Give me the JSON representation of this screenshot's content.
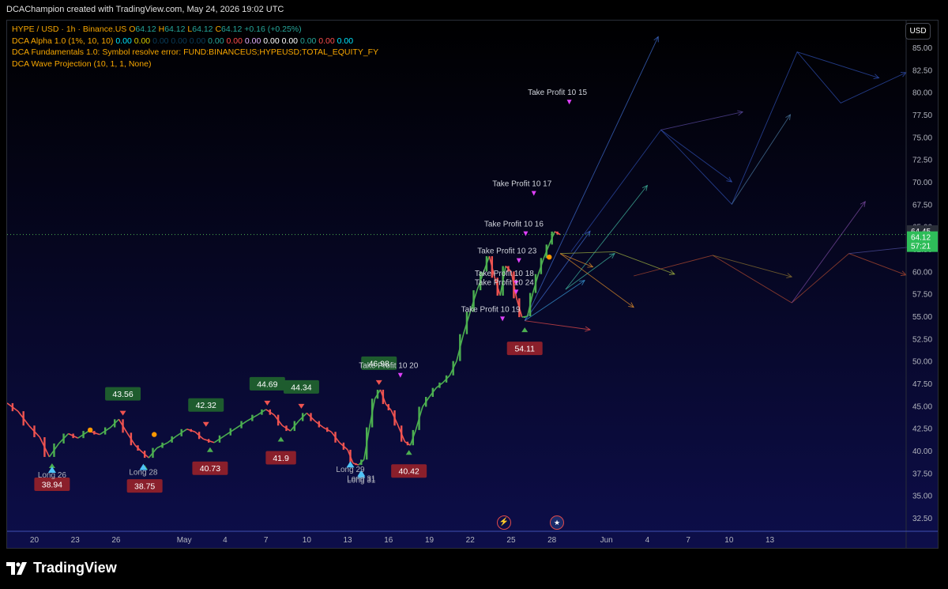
{
  "header": {
    "watermark": "DCAChampion created with TradingView.com, May 24, 2026 19:02 UTC",
    "currency_button": "USD"
  },
  "legend": {
    "symbol": "HYPE / USD · 1h · Binance.US",
    "o_label": "O",
    "o_value": "64.12",
    "h_label": "H",
    "h_value": "64.12",
    "l_label": "L",
    "l_value": "64.12",
    "c_label": "C",
    "c_value": "64.12",
    "change": "+0.16 (+0.25%)",
    "dca_alpha": "DCA Alpha 1.0 (1%, 10, 10)",
    "dca_alpha_values": [
      "0.00",
      "0.00",
      "0.00",
      "0.00",
      "0.00",
      "0.00",
      "0.00",
      "0.00",
      "0.00",
      "0.00",
      "0.00",
      "0.00",
      "0.00",
      "0.00",
      "0.00"
    ],
    "dca_fundamentals": "DCA Fundamentals 1.0: Symbol resolve error: FUND:BINANCEUS;HYPEUSD;TOTAL_EQUITY_FY",
    "dca_wave": "DCA Wave Projection (10, 1, 1, None)"
  },
  "footer": {
    "brand": "TradingView"
  },
  "colors": {
    "background": "#000000",
    "chart_bg_top": "#000000",
    "chart_bg_bottom": "#0d0e4a",
    "up": "#4caf50",
    "down": "#ef5350",
    "label_green": "#1e5c2e",
    "label_red": "#8a1f2b",
    "price_line": "#4caf50",
    "price_badge": "#2ebd59"
  },
  "chart_data": {
    "type": "candlestick",
    "y_ticks": [
      "85.00",
      "82.50",
      "80.00",
      "77.50",
      "75.00",
      "72.50",
      "70.00",
      "67.50",
      "65.00",
      "62.50",
      "60.00",
      "57.50",
      "55.00",
      "52.50",
      "50.00",
      "47.50",
      "45.00",
      "42.50",
      "40.00",
      "37.50",
      "35.00",
      "32.50"
    ],
    "ylim": [
      31,
      88
    ],
    "x_ticks": [
      "20",
      "23",
      "26",
      "May",
      "4",
      "7",
      "10",
      "13",
      "16",
      "19",
      "22",
      "25",
      "28",
      "Jun",
      "4",
      "7",
      "10",
      "13"
    ],
    "x_tick_days": [
      -11,
      -8,
      -5,
      0,
      3,
      6,
      9,
      12,
      15,
      18,
      21,
      24,
      27,
      31,
      34,
      37,
      40,
      43
    ],
    "x_range_days": [
      -13,
      53
    ],
    "current_price": {
      "value": 64.12,
      "badge_value": "64.12",
      "countdown": "57:21"
    },
    "high_badge": {
      "value": 64.45,
      "label": "64.45"
    },
    "price_path": [
      [
        -13,
        45.3
      ],
      [
        -12.2,
        44.4
      ],
      [
        -11.4,
        42.8
      ],
      [
        -10.6,
        41.5
      ],
      [
        -9.9,
        39.3
      ],
      [
        -9.2,
        40.8
      ],
      [
        -8.5,
        41.9
      ],
      [
        -7.8,
        41.4
      ],
      [
        -7.0,
        42.2
      ],
      [
        -6.2,
        41.8
      ],
      [
        -5.4,
        42.6
      ],
      [
        -4.8,
        43.5
      ],
      [
        -4.2,
        42.0
      ],
      [
        -3.6,
        40.6
      ],
      [
        -3.2,
        40.0
      ],
      [
        -2.6,
        39.2
      ],
      [
        -2.0,
        40.3
      ],
      [
        -1.2,
        40.9
      ],
      [
        -0.6,
        41.6
      ],
      [
        0.2,
        42.4
      ],
      [
        0.8,
        42.1
      ],
      [
        1.4,
        41.3
      ],
      [
        2.2,
        40.9
      ],
      [
        3.0,
        41.7
      ],
      [
        3.8,
        42.5
      ],
      [
        4.6,
        43.3
      ],
      [
        5.4,
        44.0
      ],
      [
        6.0,
        44.6
      ],
      [
        6.6,
        44.0
      ],
      [
        7.2,
        42.8
      ],
      [
        7.8,
        42.2
      ],
      [
        8.4,
        43.3
      ],
      [
        9.0,
        44.2
      ],
      [
        9.6,
        43.3
      ],
      [
        10.2,
        42.6
      ],
      [
        10.8,
        42.1
      ],
      [
        11.4,
        40.9
      ],
      [
        12.0,
        40.1
      ],
      [
        12.4,
        38.6
      ],
      [
        12.8,
        38.4
      ],
      [
        13.2,
        39.0
      ],
      [
        13.6,
        42.6
      ],
      [
        14.0,
        45.8
      ],
      [
        14.4,
        46.8
      ],
      [
        14.8,
        45.2
      ],
      [
        15.2,
        44.5
      ],
      [
        15.7,
        42.8
      ],
      [
        16.2,
        41.0
      ],
      [
        16.6,
        40.6
      ],
      [
        17.0,
        42.3
      ],
      [
        17.5,
        44.9
      ],
      [
        18.0,
        46.0
      ],
      [
        18.5,
        47.0
      ],
      [
        19.0,
        47.6
      ],
      [
        19.5,
        48.4
      ],
      [
        20.0,
        50.0
      ],
      [
        20.5,
        53.0
      ],
      [
        21.0,
        55.5
      ],
      [
        21.5,
        57.9
      ],
      [
        22.0,
        60.0
      ],
      [
        22.4,
        61.7
      ],
      [
        22.8,
        59.3
      ],
      [
        23.2,
        57.3
      ],
      [
        23.6,
        60.6
      ],
      [
        24.0,
        60.0
      ],
      [
        24.4,
        57.0
      ],
      [
        24.8,
        54.9
      ],
      [
        25.2,
        55.0
      ],
      [
        25.6,
        57.6
      ],
      [
        26.0,
        59.7
      ],
      [
        26.4,
        61.5
      ],
      [
        26.8,
        63.0
      ],
      [
        27.2,
        64.45
      ],
      [
        27.6,
        64.12
      ]
    ],
    "value_labels": [
      {
        "text": "43.56",
        "day": -4.5,
        "price": 43.56,
        "kind": "high"
      },
      {
        "text": "42.32",
        "day": 1.6,
        "price": 42.32,
        "kind": "high"
      },
      {
        "text": "44.69",
        "day": 6.1,
        "price": 44.69,
        "kind": "high"
      },
      {
        "text": "44.34",
        "day": 8.6,
        "price": 44.34,
        "kind": "high"
      },
      {
        "text": "46.98",
        "day": 14.3,
        "price": 46.98,
        "kind": "high"
      },
      {
        "text": "38.94",
        "day": -9.7,
        "price": 38.94,
        "kind": "low"
      },
      {
        "text": "38.75",
        "day": -2.9,
        "price": 38.75,
        "kind": "low"
      },
      {
        "text": "40.73",
        "day": 1.9,
        "price": 40.73,
        "kind": "low"
      },
      {
        "text": "41.9",
        "day": 7.1,
        "price": 41.9,
        "kind": "low"
      },
      {
        "text": "40.42",
        "day": 16.5,
        "price": 40.42,
        "kind": "low"
      },
      {
        "text": "54.11",
        "day": 25.0,
        "price": 54.11,
        "kind": "low"
      }
    ],
    "annotations": [
      {
        "text": "Take Profit 10 15",
        "day": 27.4
      },
      {
        "text": "Take Profit 10 17",
        "day": 24.8
      },
      {
        "text": "Take Profit 10 16",
        "day": 24.2
      },
      {
        "text": "Take Profit 10 23",
        "day": 23.7
      },
      {
        "text": "Take Profit 10 18",
        "day": 23.5
      },
      {
        "text": "Take Profit 10 24",
        "day": 23.5
      },
      {
        "text": "Take Profit 10 19",
        "day": 22.5
      },
      {
        "text": "Take Profit 10 20",
        "day": 15.0
      },
      {
        "text": "Long 26",
        "day": -9.7
      },
      {
        "text": "Long 28",
        "day": -3.0
      },
      {
        "text": "Long 29",
        "day": 12.2
      },
      {
        "text": "Long 31",
        "day": 13.0
      },
      {
        "text": "Long 31",
        "day": 13.0
      }
    ],
    "wave_projection": [
      {
        "color": "#3f6ccf",
        "points": [
          [
            25.0,
            54.5
          ],
          [
            34.8,
            86.2
          ]
        ]
      },
      {
        "color": "#3f6ccf",
        "points": [
          [
            25.0,
            54.5
          ],
          [
            29.8,
            64.5
          ]
        ]
      },
      {
        "color": "#3a9ad8",
        "points": [
          [
            25.0,
            54.5
          ],
          [
            29.4,
            59.0
          ]
        ]
      },
      {
        "color": "#e04a4a",
        "points": [
          [
            25.0,
            54.5
          ],
          [
            29.8,
            53.5
          ]
        ]
      },
      {
        "color": "#41b8a0",
        "points": [
          [
            28.0,
            58.0
          ],
          [
            34.0,
            69.6
          ]
        ]
      },
      {
        "color": "#41b8a0",
        "points": [
          [
            28.0,
            58.0
          ],
          [
            31.6,
            62.0
          ]
        ]
      },
      {
        "color": "#9fb040",
        "points": [
          [
            27.6,
            62.0
          ],
          [
            31.6,
            62.2
          ],
          [
            36.0,
            59.7
          ]
        ]
      },
      {
        "color": "#d98a2a",
        "points": [
          [
            27.6,
            62.0
          ],
          [
            33.0,
            56.0
          ]
        ]
      },
      {
        "color": "#d98a2a",
        "points": [
          [
            27.6,
            62.0
          ],
          [
            30.0,
            60.5
          ]
        ]
      },
      {
        "color": "#2f4fb0",
        "points": [
          [
            28.4,
            62.2
          ],
          [
            35.0,
            75.8
          ],
          [
            40.2,
            67.5
          ],
          [
            45.0,
            84.5
          ],
          [
            48.2,
            78.8
          ],
          [
            53.0,
            82.2
          ]
        ]
      },
      {
        "color": "#2f4fb0",
        "points": [
          [
            35.0,
            75.8
          ],
          [
            40.2,
            70.0
          ]
        ]
      },
      {
        "color": "#2f4fb0",
        "points": [
          [
            45.0,
            84.5
          ],
          [
            51.0,
            81.6
          ]
        ]
      },
      {
        "color": "#5a4aa0",
        "points": [
          [
            35.0,
            75.8
          ],
          [
            41.0,
            77.8
          ]
        ]
      },
      {
        "color": "#4a78a0",
        "points": [
          [
            40.2,
            67.5
          ],
          [
            44.5,
            77.5
          ]
        ]
      },
      {
        "color": "#b04a30",
        "points": [
          [
            33.0,
            59.5
          ],
          [
            38.8,
            61.8
          ],
          [
            44.6,
            56.5
          ],
          [
            48.8,
            62.0
          ],
          [
            53.0,
            59.6
          ]
        ]
      },
      {
        "color": "#8a7030",
        "points": [
          [
            38.8,
            61.8
          ],
          [
            44.6,
            59.4
          ]
        ]
      },
      {
        "color": "#7a4aa0",
        "points": [
          [
            44.6,
            56.5
          ],
          [
            50.0,
            67.8
          ]
        ]
      },
      {
        "color": "#5050a0",
        "points": [
          [
            48.8,
            62.0
          ],
          [
            55.0,
            63.0
          ]
        ]
      }
    ]
  }
}
